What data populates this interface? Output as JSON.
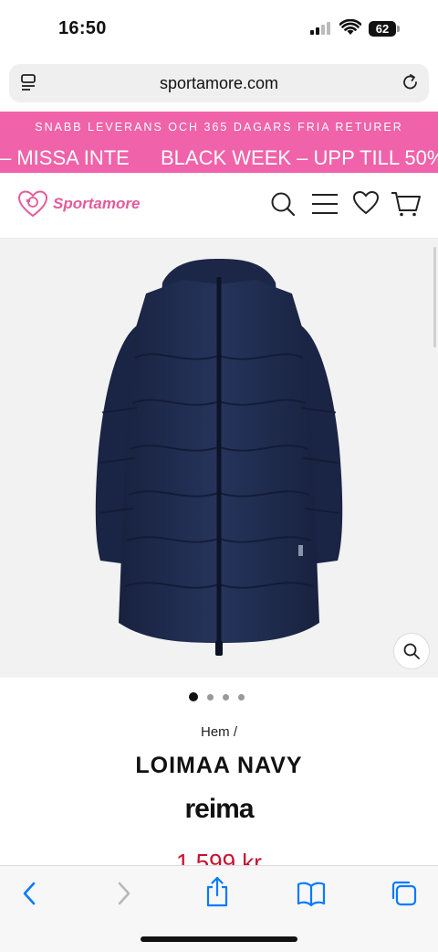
{
  "status": {
    "time": "16:50",
    "battery": "62"
  },
  "browser": {
    "url": "sportamore.com"
  },
  "promo": {
    "top_line": "SNABB LEVERANS OCH 365 DAGARS FRIA RETURER",
    "bottom_left": "– MISSA INTE",
    "bottom_right": "BLACK WEEK – UPP TILL 50%"
  },
  "site": {
    "logo_text": "Sportamore",
    "brand_color": "#e45b9c"
  },
  "product": {
    "breadcrumb": "Hem /",
    "title": "LOIMAA NAVY",
    "brand": "reima",
    "price": "1 599 kr",
    "image_count": 4,
    "active_image": 1,
    "jacket_color": "#1f2b4d"
  },
  "colors": {
    "promo_bg": "#f062a9",
    "price": "#c8102e",
    "ios_blue": "#0a7aff"
  }
}
